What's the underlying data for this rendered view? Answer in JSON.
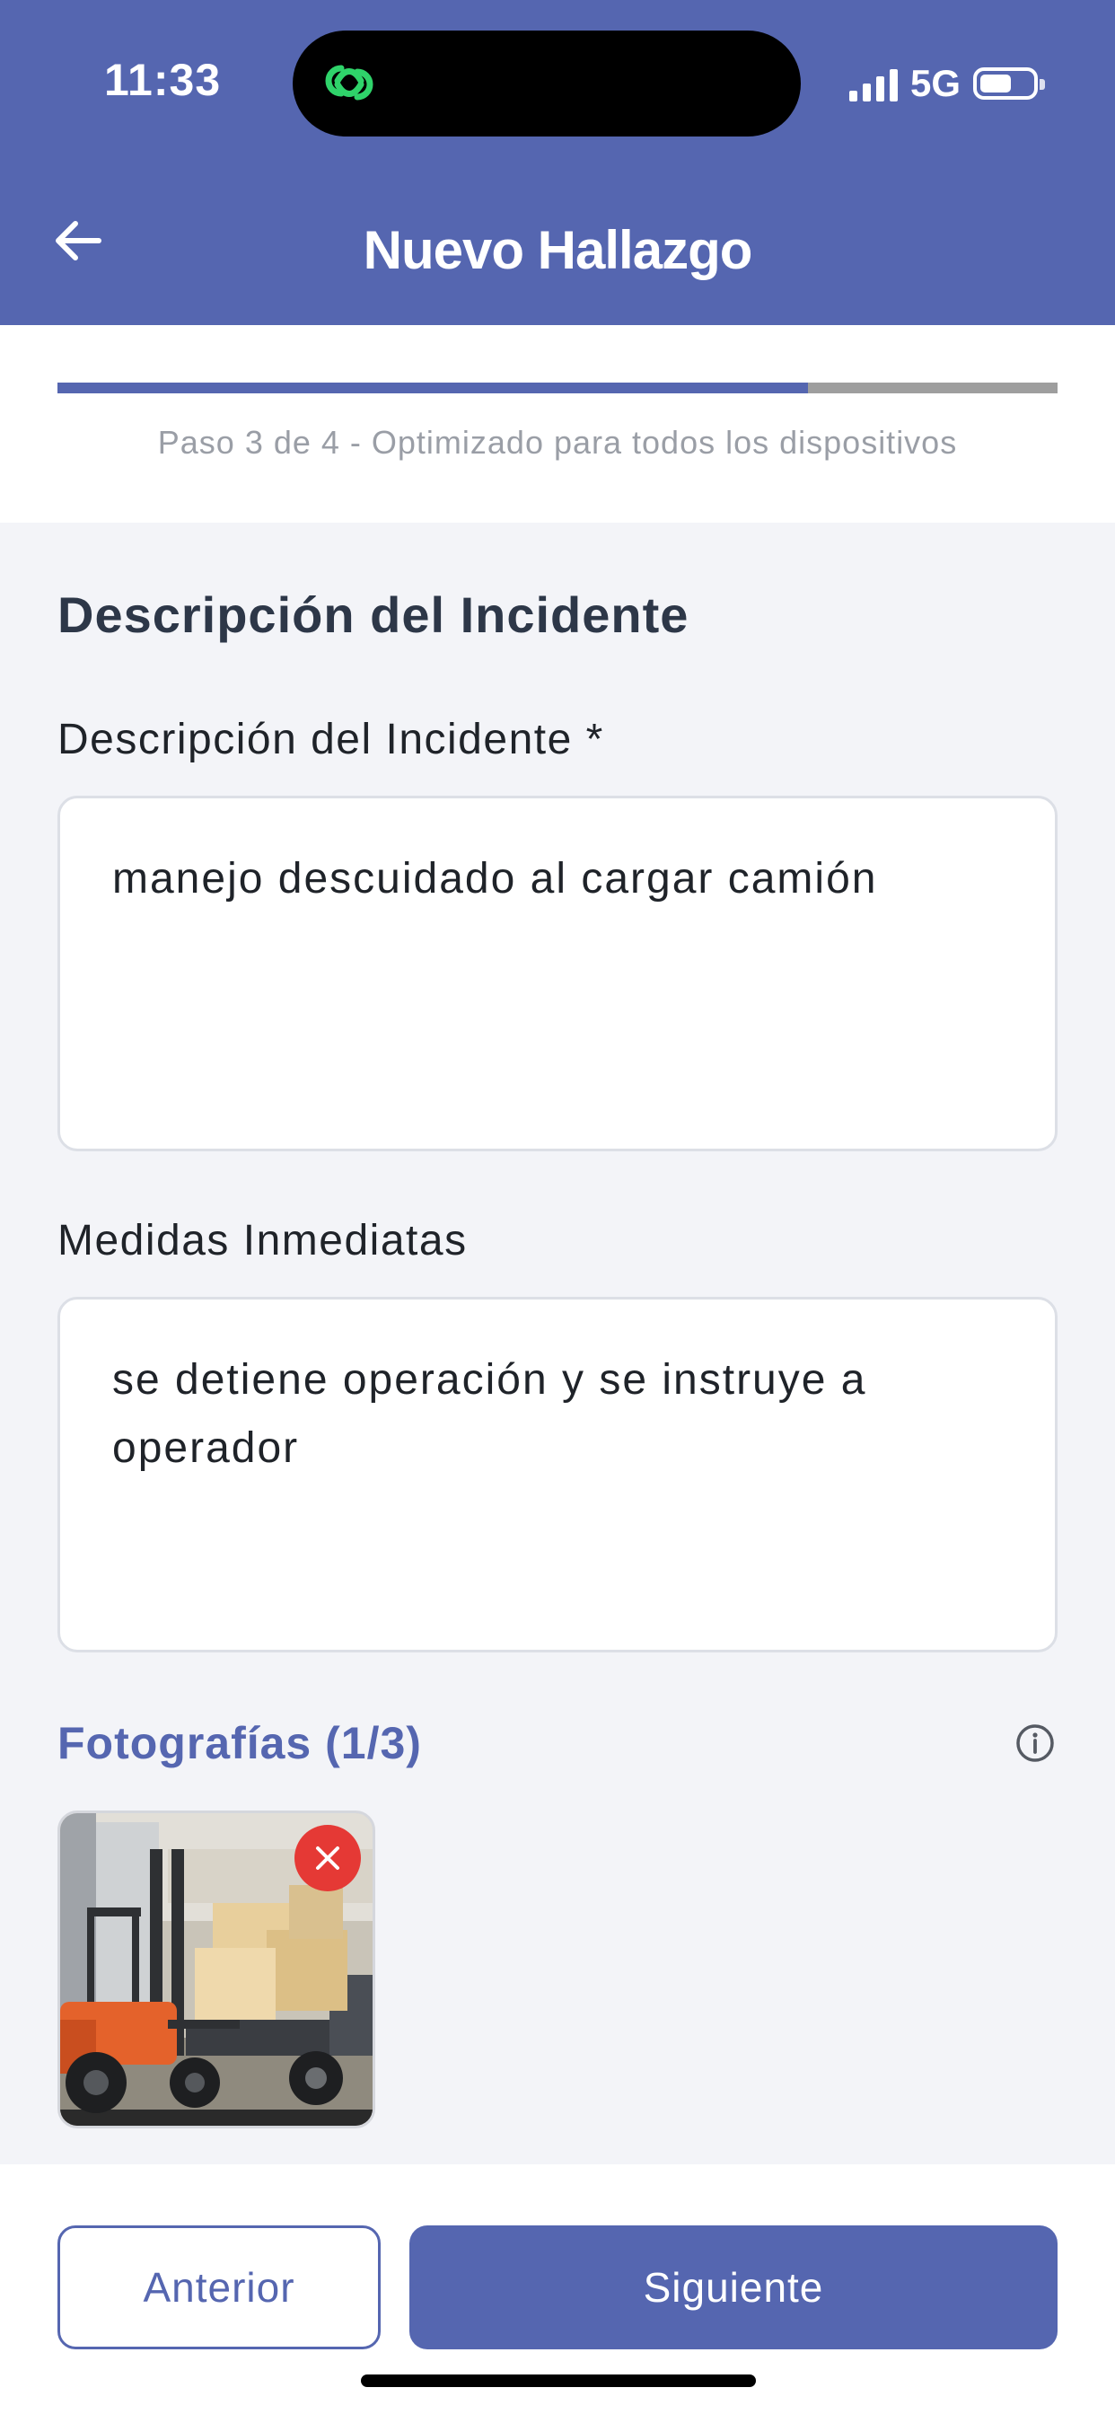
{
  "status_bar": {
    "time": "11:33",
    "network": "5G",
    "battery_level": 0.6
  },
  "header": {
    "title": "Nuevo Hallazgo"
  },
  "progress": {
    "fraction": 0.75,
    "text": "Paso 3 de 4 - Optimizado para todos los dispositivos"
  },
  "section": {
    "title": "Descripción del Incidente"
  },
  "fields": {
    "description": {
      "label": "Descripción del Incidente *",
      "value": "manejo descuidado al cargar camión"
    },
    "measures": {
      "label": "Medidas Inmediatas",
      "value": "se detiene operación y se instruye a operador"
    }
  },
  "photos": {
    "label": "Fotografías (1/3)"
  },
  "footer": {
    "prev_label": "Anterior",
    "next_label": "Siguiente"
  },
  "colors": {
    "primary": "#5566b0",
    "remove": "#e53935",
    "track": "#9e9e9e"
  }
}
